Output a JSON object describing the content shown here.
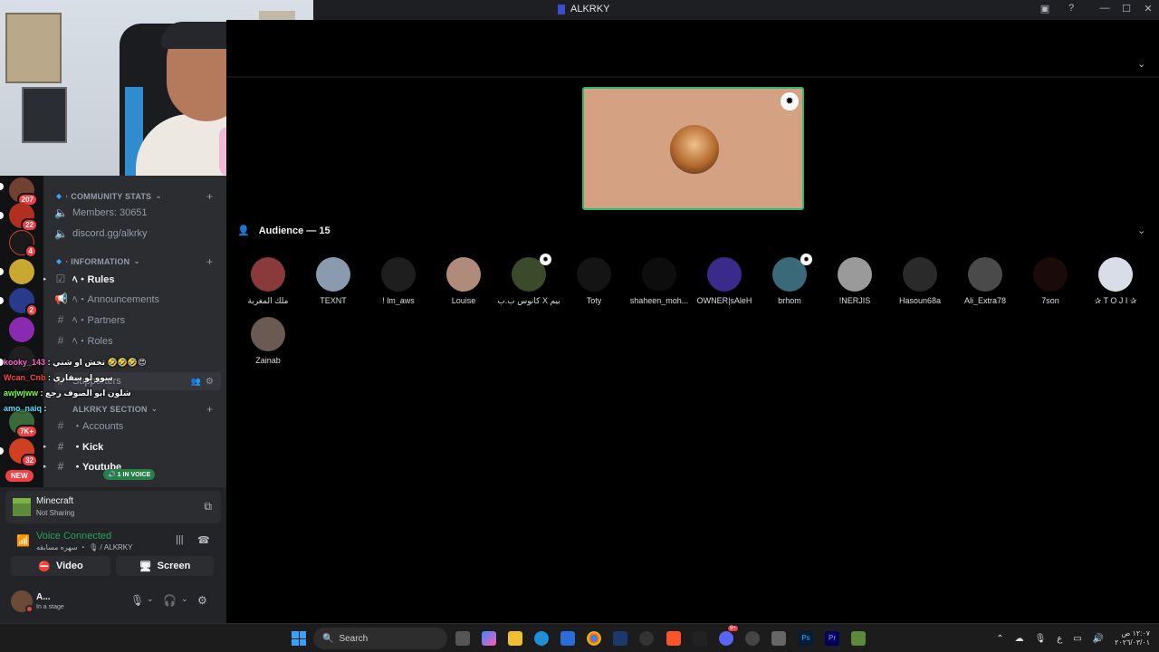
{
  "window": {
    "title": "ALKRKY"
  },
  "server_badges": [
    "207",
    "22",
    "4",
    "2",
    "7K+",
    "32"
  ],
  "new_badge": "NEW",
  "sidebar": {
    "community_stats": "· COMMUNITY STATS",
    "members": "Members: 30651",
    "invite": "discord.gg/alkrky",
    "information": "· INFORMATION",
    "rules": "ﾍ・Rules",
    "announcements": "ﾍ・Announcements",
    "partners": "ﾍ・Partners",
    "roles_channel": "ﾍ・Roles",
    "supporters": "Supporters",
    "alkrky_section": "ALKRKY SECTION",
    "accounts": "・Accounts",
    "kick": "・Kick",
    "youtube": "・Youtube",
    "in_voice": "1 IN VOICE"
  },
  "chat_overlay": [
    {
      "user": "kooky_143",
      "text": ": تخش او شني 🤣🤣🤣😍",
      "color": "#ff66cc"
    },
    {
      "user": "Wcan_Cnb",
      "text": ": سوو لو سفاري",
      "color": "#ff4444"
    },
    {
      "user": "awjwjww",
      "text": ": شلون ابو الصوف رجع",
      "color": "#7cff4a"
    },
    {
      "user": "amo_naiq",
      "text": ":",
      "color": "#55e0ff"
    }
  ],
  "panel": {
    "activity_title": "Minecraft",
    "activity_sub": "Not Sharing",
    "voice_status": "Voice Connected",
    "voice_channel": "سهره مسابقه ・ 🎙 / ALKRKY",
    "video_btn": "Video",
    "screen_btn": "Screen",
    "user_name": "A...",
    "user_status": "In a stage"
  },
  "stage": {
    "audience_header": "Audience — 15",
    "audience": [
      {
        "name": "ملك المغربة",
        "color": "#8a3a3a",
        "mod": false
      },
      {
        "name": "TEXNT",
        "color": "#8a9bb0",
        "mod": false
      },
      {
        "name": "! lm_aws",
        "color": "#1e1e1e",
        "mod": false
      },
      {
        "name": "Louise",
        "color": "#b08a7a",
        "mod": false
      },
      {
        "name": "كانوس ب.ب X بيم",
        "color": "#3a4a2a",
        "mod": true
      },
      {
        "name": "Toty",
        "color": "#141414",
        "mod": false
      },
      {
        "name": "shaheen_moh...",
        "color": "#0d0d0d",
        "mod": false
      },
      {
        "name": "OWNER|sAleH",
        "color": "#3a2a8a",
        "mod": false
      },
      {
        "name": "brhom",
        "color": "#3a6a7a",
        "mod": true
      },
      {
        "name": "!NERJIS",
        "color": "#9a9a9a",
        "mod": false
      },
      {
        "name": "Hasoun68a",
        "color": "#2a2a2a",
        "mod": false
      },
      {
        "name": "Ali_Extra78",
        "color": "#4a4a4a",
        "mod": false
      },
      {
        "name": "7son",
        "color": "#1a0a0a",
        "mod": false
      },
      {
        "name": "✰ T O J I ✰",
        "color": "#d8dde8",
        "mod": false
      },
      {
        "name": "Zainab",
        "color": "#6a5a52",
        "mod": false
      }
    ]
  },
  "taskbar": {
    "search_placeholder": "Search",
    "notif": "9+",
    "clock_time": "١٢:٠٧ ص",
    "clock_date": "٢٠٢٦/٠٣/٠١",
    "lang": "ع"
  }
}
